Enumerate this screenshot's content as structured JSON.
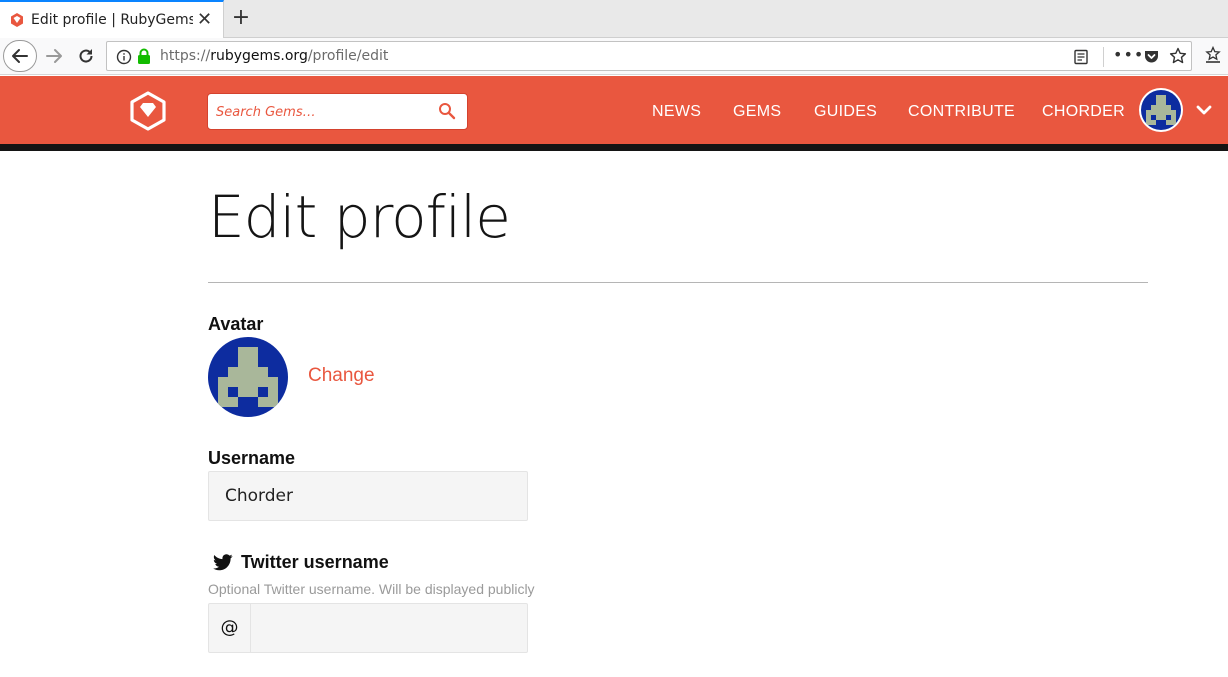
{
  "browser": {
    "tab_title": "Edit profile | RubyGems.org | your community gem host",
    "close_glyph": "✕",
    "newtab_glyph": "+",
    "url_scheme": "https://",
    "url_host": "rubygems.org",
    "url_path": "/profile/edit",
    "more_glyph": "•••"
  },
  "header": {
    "search_placeholder": "Search Gems…",
    "nav": [
      "NEWS",
      "GEMS",
      "GUIDES",
      "CONTRIBUTE",
      "CHORDER"
    ],
    "brand_color": "#e9573f"
  },
  "page": {
    "title": "Edit profile",
    "avatar_label": "Avatar",
    "change_link": "Change",
    "username_label": "Username",
    "username_value": "Chorder",
    "twitter_label": "Twitter username",
    "twitter_hint": "Optional Twitter username. Will be displayed publicly",
    "twitter_prefix": "@",
    "twitter_value": ""
  },
  "icons": {
    "favicon": "rubygems-favicon-icon",
    "back": "back-arrow-icon",
    "forward": "forward-arrow-icon",
    "reload": "reload-icon",
    "info": "info-icon",
    "lock": "lock-icon",
    "reader": "reader-view-icon",
    "pocket": "pocket-icon",
    "star": "bookmark-star-icon",
    "library": "library-icon",
    "logo": "rubygems-logo-icon",
    "search": "search-icon",
    "chevron": "chevron-down-icon",
    "twitter": "twitter-icon"
  }
}
